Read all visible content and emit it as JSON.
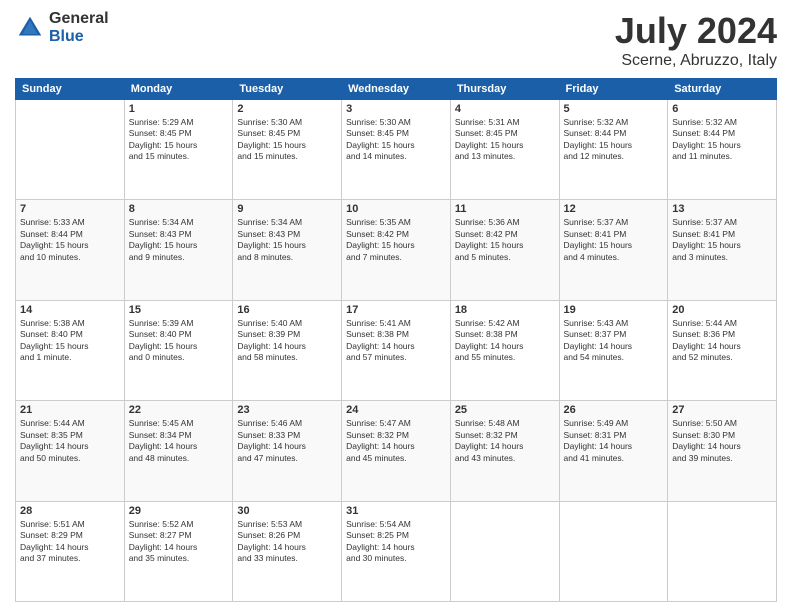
{
  "logo": {
    "general": "General",
    "blue": "Blue"
  },
  "title": "July 2024",
  "subtitle": "Scerne, Abruzzo, Italy",
  "days_header": [
    "Sunday",
    "Monday",
    "Tuesday",
    "Wednesday",
    "Thursday",
    "Friday",
    "Saturday"
  ],
  "weeks": [
    [
      {
        "day": "",
        "info": ""
      },
      {
        "day": "1",
        "info": "Sunrise: 5:29 AM\nSunset: 8:45 PM\nDaylight: 15 hours\nand 15 minutes."
      },
      {
        "day": "2",
        "info": "Sunrise: 5:30 AM\nSunset: 8:45 PM\nDaylight: 15 hours\nand 15 minutes."
      },
      {
        "day": "3",
        "info": "Sunrise: 5:30 AM\nSunset: 8:45 PM\nDaylight: 15 hours\nand 14 minutes."
      },
      {
        "day": "4",
        "info": "Sunrise: 5:31 AM\nSunset: 8:45 PM\nDaylight: 15 hours\nand 13 minutes."
      },
      {
        "day": "5",
        "info": "Sunrise: 5:32 AM\nSunset: 8:44 PM\nDaylight: 15 hours\nand 12 minutes."
      },
      {
        "day": "6",
        "info": "Sunrise: 5:32 AM\nSunset: 8:44 PM\nDaylight: 15 hours\nand 11 minutes."
      }
    ],
    [
      {
        "day": "7",
        "info": "Sunrise: 5:33 AM\nSunset: 8:44 PM\nDaylight: 15 hours\nand 10 minutes."
      },
      {
        "day": "8",
        "info": "Sunrise: 5:34 AM\nSunset: 8:43 PM\nDaylight: 15 hours\nand 9 minutes."
      },
      {
        "day": "9",
        "info": "Sunrise: 5:34 AM\nSunset: 8:43 PM\nDaylight: 15 hours\nand 8 minutes."
      },
      {
        "day": "10",
        "info": "Sunrise: 5:35 AM\nSunset: 8:42 PM\nDaylight: 15 hours\nand 7 minutes."
      },
      {
        "day": "11",
        "info": "Sunrise: 5:36 AM\nSunset: 8:42 PM\nDaylight: 15 hours\nand 5 minutes."
      },
      {
        "day": "12",
        "info": "Sunrise: 5:37 AM\nSunset: 8:41 PM\nDaylight: 15 hours\nand 4 minutes."
      },
      {
        "day": "13",
        "info": "Sunrise: 5:37 AM\nSunset: 8:41 PM\nDaylight: 15 hours\nand 3 minutes."
      }
    ],
    [
      {
        "day": "14",
        "info": "Sunrise: 5:38 AM\nSunset: 8:40 PM\nDaylight: 15 hours\nand 1 minute."
      },
      {
        "day": "15",
        "info": "Sunrise: 5:39 AM\nSunset: 8:40 PM\nDaylight: 15 hours\nand 0 minutes."
      },
      {
        "day": "16",
        "info": "Sunrise: 5:40 AM\nSunset: 8:39 PM\nDaylight: 14 hours\nand 58 minutes."
      },
      {
        "day": "17",
        "info": "Sunrise: 5:41 AM\nSunset: 8:38 PM\nDaylight: 14 hours\nand 57 minutes."
      },
      {
        "day": "18",
        "info": "Sunrise: 5:42 AM\nSunset: 8:38 PM\nDaylight: 14 hours\nand 55 minutes."
      },
      {
        "day": "19",
        "info": "Sunrise: 5:43 AM\nSunset: 8:37 PM\nDaylight: 14 hours\nand 54 minutes."
      },
      {
        "day": "20",
        "info": "Sunrise: 5:44 AM\nSunset: 8:36 PM\nDaylight: 14 hours\nand 52 minutes."
      }
    ],
    [
      {
        "day": "21",
        "info": "Sunrise: 5:44 AM\nSunset: 8:35 PM\nDaylight: 14 hours\nand 50 minutes."
      },
      {
        "day": "22",
        "info": "Sunrise: 5:45 AM\nSunset: 8:34 PM\nDaylight: 14 hours\nand 48 minutes."
      },
      {
        "day": "23",
        "info": "Sunrise: 5:46 AM\nSunset: 8:33 PM\nDaylight: 14 hours\nand 47 minutes."
      },
      {
        "day": "24",
        "info": "Sunrise: 5:47 AM\nSunset: 8:32 PM\nDaylight: 14 hours\nand 45 minutes."
      },
      {
        "day": "25",
        "info": "Sunrise: 5:48 AM\nSunset: 8:32 PM\nDaylight: 14 hours\nand 43 minutes."
      },
      {
        "day": "26",
        "info": "Sunrise: 5:49 AM\nSunset: 8:31 PM\nDaylight: 14 hours\nand 41 minutes."
      },
      {
        "day": "27",
        "info": "Sunrise: 5:50 AM\nSunset: 8:30 PM\nDaylight: 14 hours\nand 39 minutes."
      }
    ],
    [
      {
        "day": "28",
        "info": "Sunrise: 5:51 AM\nSunset: 8:29 PM\nDaylight: 14 hours\nand 37 minutes."
      },
      {
        "day": "29",
        "info": "Sunrise: 5:52 AM\nSunset: 8:27 PM\nDaylight: 14 hours\nand 35 minutes."
      },
      {
        "day": "30",
        "info": "Sunrise: 5:53 AM\nSunset: 8:26 PM\nDaylight: 14 hours\nand 33 minutes."
      },
      {
        "day": "31",
        "info": "Sunrise: 5:54 AM\nSunset: 8:25 PM\nDaylight: 14 hours\nand 30 minutes."
      },
      {
        "day": "",
        "info": ""
      },
      {
        "day": "",
        "info": ""
      },
      {
        "day": "",
        "info": ""
      }
    ]
  ]
}
